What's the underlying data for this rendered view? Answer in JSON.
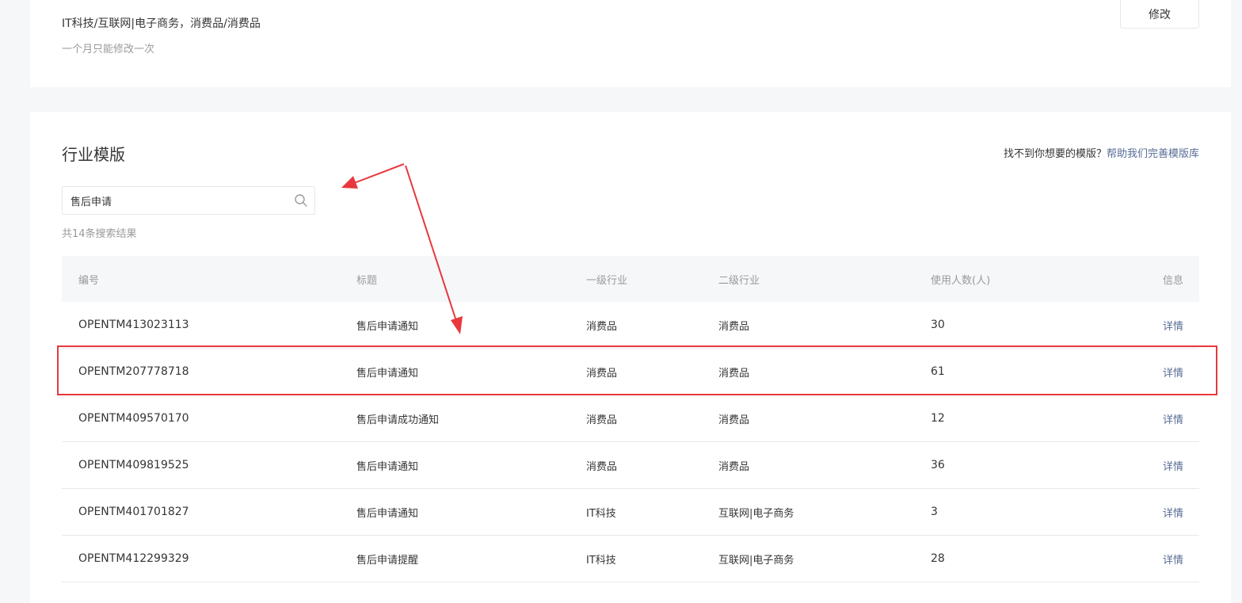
{
  "industry": {
    "value": "IT科技/互联网|电子商务，消费品/消费品",
    "hint": "一个月只能修改一次",
    "edit_label": "修改"
  },
  "templates": {
    "title": "行业模版",
    "help_prefix": "找不到你想要的模版？",
    "help_link": "帮助我们完善模版库",
    "search": {
      "value": "售后申请"
    },
    "result_count": "共14条搜索结果",
    "columns": {
      "id": "编号",
      "title": "标题",
      "level1": "一级行业",
      "level2": "二级行业",
      "users": "使用人数(人)",
      "info": "信息"
    },
    "rows": [
      {
        "id": "OPENTM413023113",
        "title": "售后申请通知",
        "level1": "消费品",
        "level2": "消费品",
        "users": "30",
        "info": "详情"
      },
      {
        "id": "OPENTM207778718",
        "title": "售后申请通知",
        "level1": "消费品",
        "level2": "消费品",
        "users": "61",
        "info": "详情"
      },
      {
        "id": "OPENTM409570170",
        "title": "售后申请成功通知",
        "level1": "消费品",
        "level2": "消费品",
        "users": "12",
        "info": "详情"
      },
      {
        "id": "OPENTM409819525",
        "title": "售后申请通知",
        "level1": "消费品",
        "level2": "消费品",
        "users": "36",
        "info": "详情"
      },
      {
        "id": "OPENTM401701827",
        "title": "售后申请通知",
        "level1": "IT科技",
        "level2": "互联网|电子商务",
        "users": "3",
        "info": "详情"
      },
      {
        "id": "OPENTM412299329",
        "title": "售后申请提醒",
        "level1": "IT科技",
        "level2": "互联网|电子商务",
        "users": "28",
        "info": "详情"
      }
    ]
  },
  "colors": {
    "link": "#576b95",
    "annotation": "#e8383d",
    "header_bg": "#f6f7f9"
  }
}
